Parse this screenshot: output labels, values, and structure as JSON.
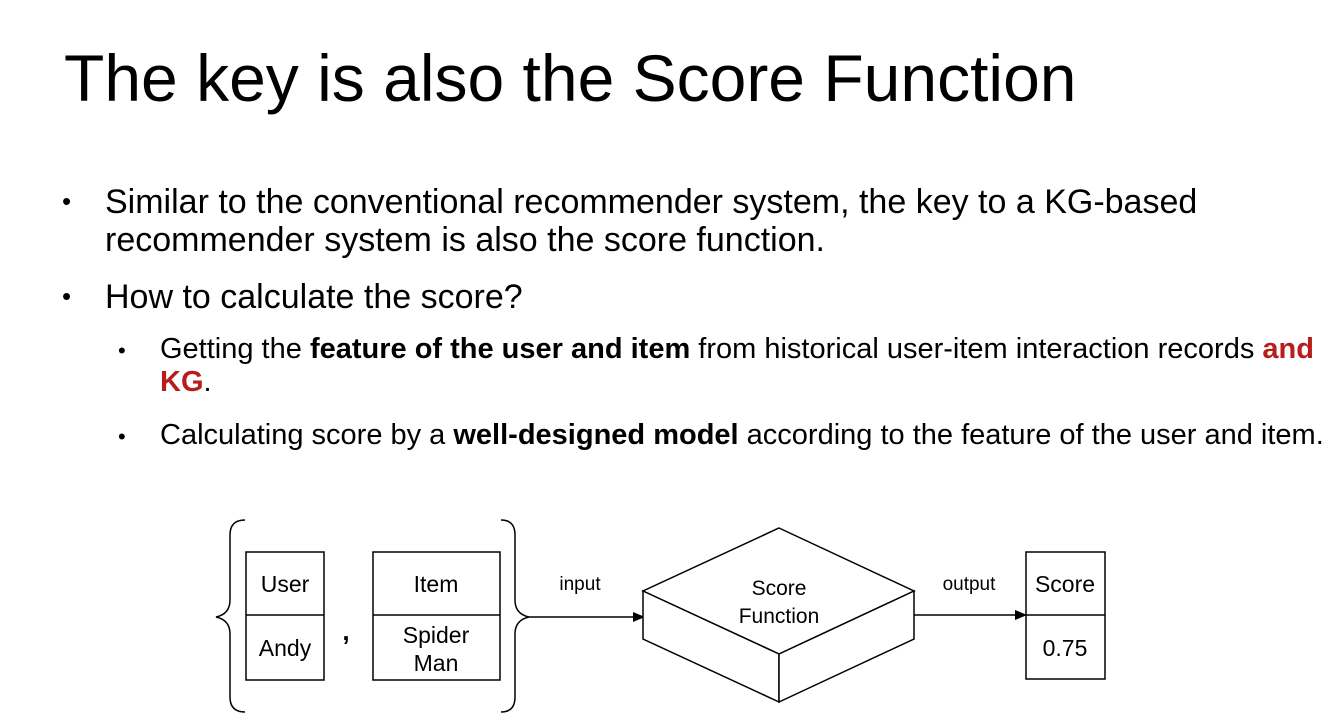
{
  "title": "The key is also the Score Function",
  "bullets": [
    {
      "text": "Similar to the conventional recommender system, the key to a KG-based recommender system is also the score function."
    },
    {
      "text": "How to calculate the score?",
      "sub": [
        {
          "t1": "Getting the ",
          "b1": "feature of the user and item",
          "t2": " from historical user-item interaction records ",
          "r1": "and KG",
          "t3": "."
        },
        {
          "t1": "Calculating score by a ",
          "b1": "well-designed model",
          "t2": " according to the feature of the user and item."
        }
      ]
    }
  ],
  "diagram": {
    "user_header": "User",
    "user_value": "Andy",
    "comma": ",",
    "item_header": "Item",
    "item_value_line1": "Spider",
    "item_value_line2": "Man",
    "input_label": "input",
    "function_line1": "Score",
    "function_line2": "Function",
    "output_label": "output",
    "score_header": "Score",
    "score_value": "0.75"
  }
}
